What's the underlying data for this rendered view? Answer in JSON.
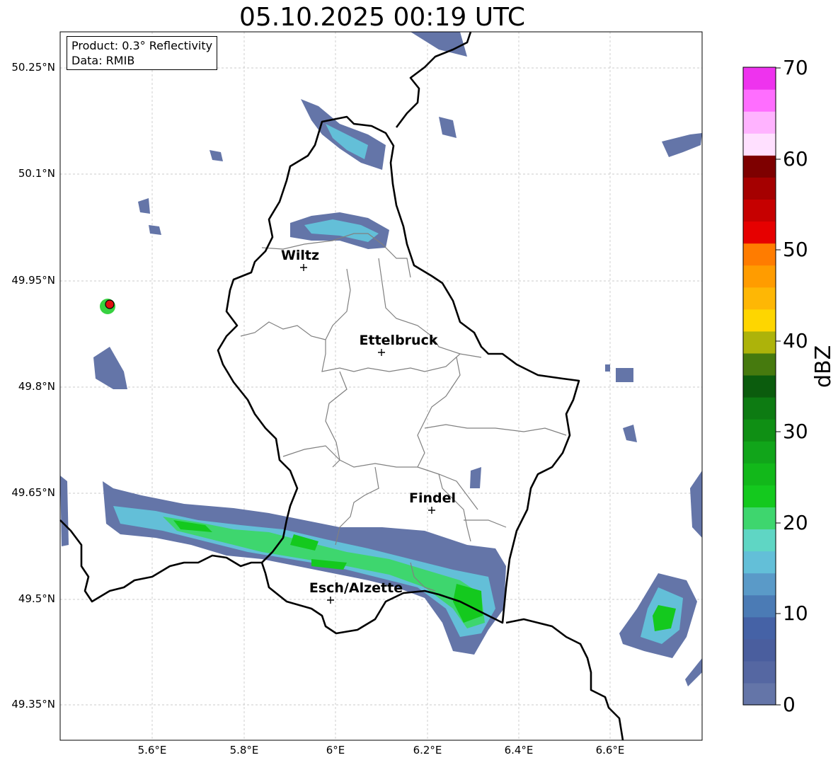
{
  "title": "05.10.2025 00:19 UTC",
  "info": {
    "product": "Product: 0.3° Reflectivity",
    "data": "Data: RMIB"
  },
  "lat_labels": [
    "50.25°N",
    "50.1°N",
    "49.95°N",
    "49.8°N",
    "49.65°N",
    "49.5°N",
    "49.35°N"
  ],
  "lon_labels": [
    "5.6°E",
    "5.8°E",
    "6°E",
    "6.2°E",
    "6.4°E",
    "6.6°E"
  ],
  "cities": [
    {
      "name": "Wiltz"
    },
    {
      "name": "Ettelbruck"
    },
    {
      "name": "Findel"
    },
    {
      "name": "Esch/Alzette"
    }
  ],
  "colorbar": {
    "label": "dBZ",
    "ticks": [
      "70",
      "60",
      "50",
      "40",
      "30",
      "20",
      "10",
      "0"
    ],
    "colors": [
      "#6475a8",
      "#5567a2",
      "#4a5e9e",
      "#4562a6",
      "#4b7bb5",
      "#5a9ac8",
      "#63bfd8",
      "#5fd6c4",
      "#3ed66e",
      "#14c91e",
      "#12b81a",
      "#11a51a",
      "#0f8f14",
      "#0d7b12",
      "#0b5c0d",
      "#467a0e",
      "#adb30a",
      "#fed600",
      "#feb705",
      "#ff9c00",
      "#ff7c00",
      "#e60000",
      "#c60000",
      "#a50000",
      "#7e0000",
      "#ffe0ff",
      "#ffb3ff",
      "#ff6eff",
      "#ee33ee"
    ]
  },
  "echo_levels": {
    "weak": "#6475a8",
    "light": "#4b7bb5",
    "moderate": "#63bfd8",
    "strong": "#3ed66e",
    "heavy": "#14c91e"
  }
}
